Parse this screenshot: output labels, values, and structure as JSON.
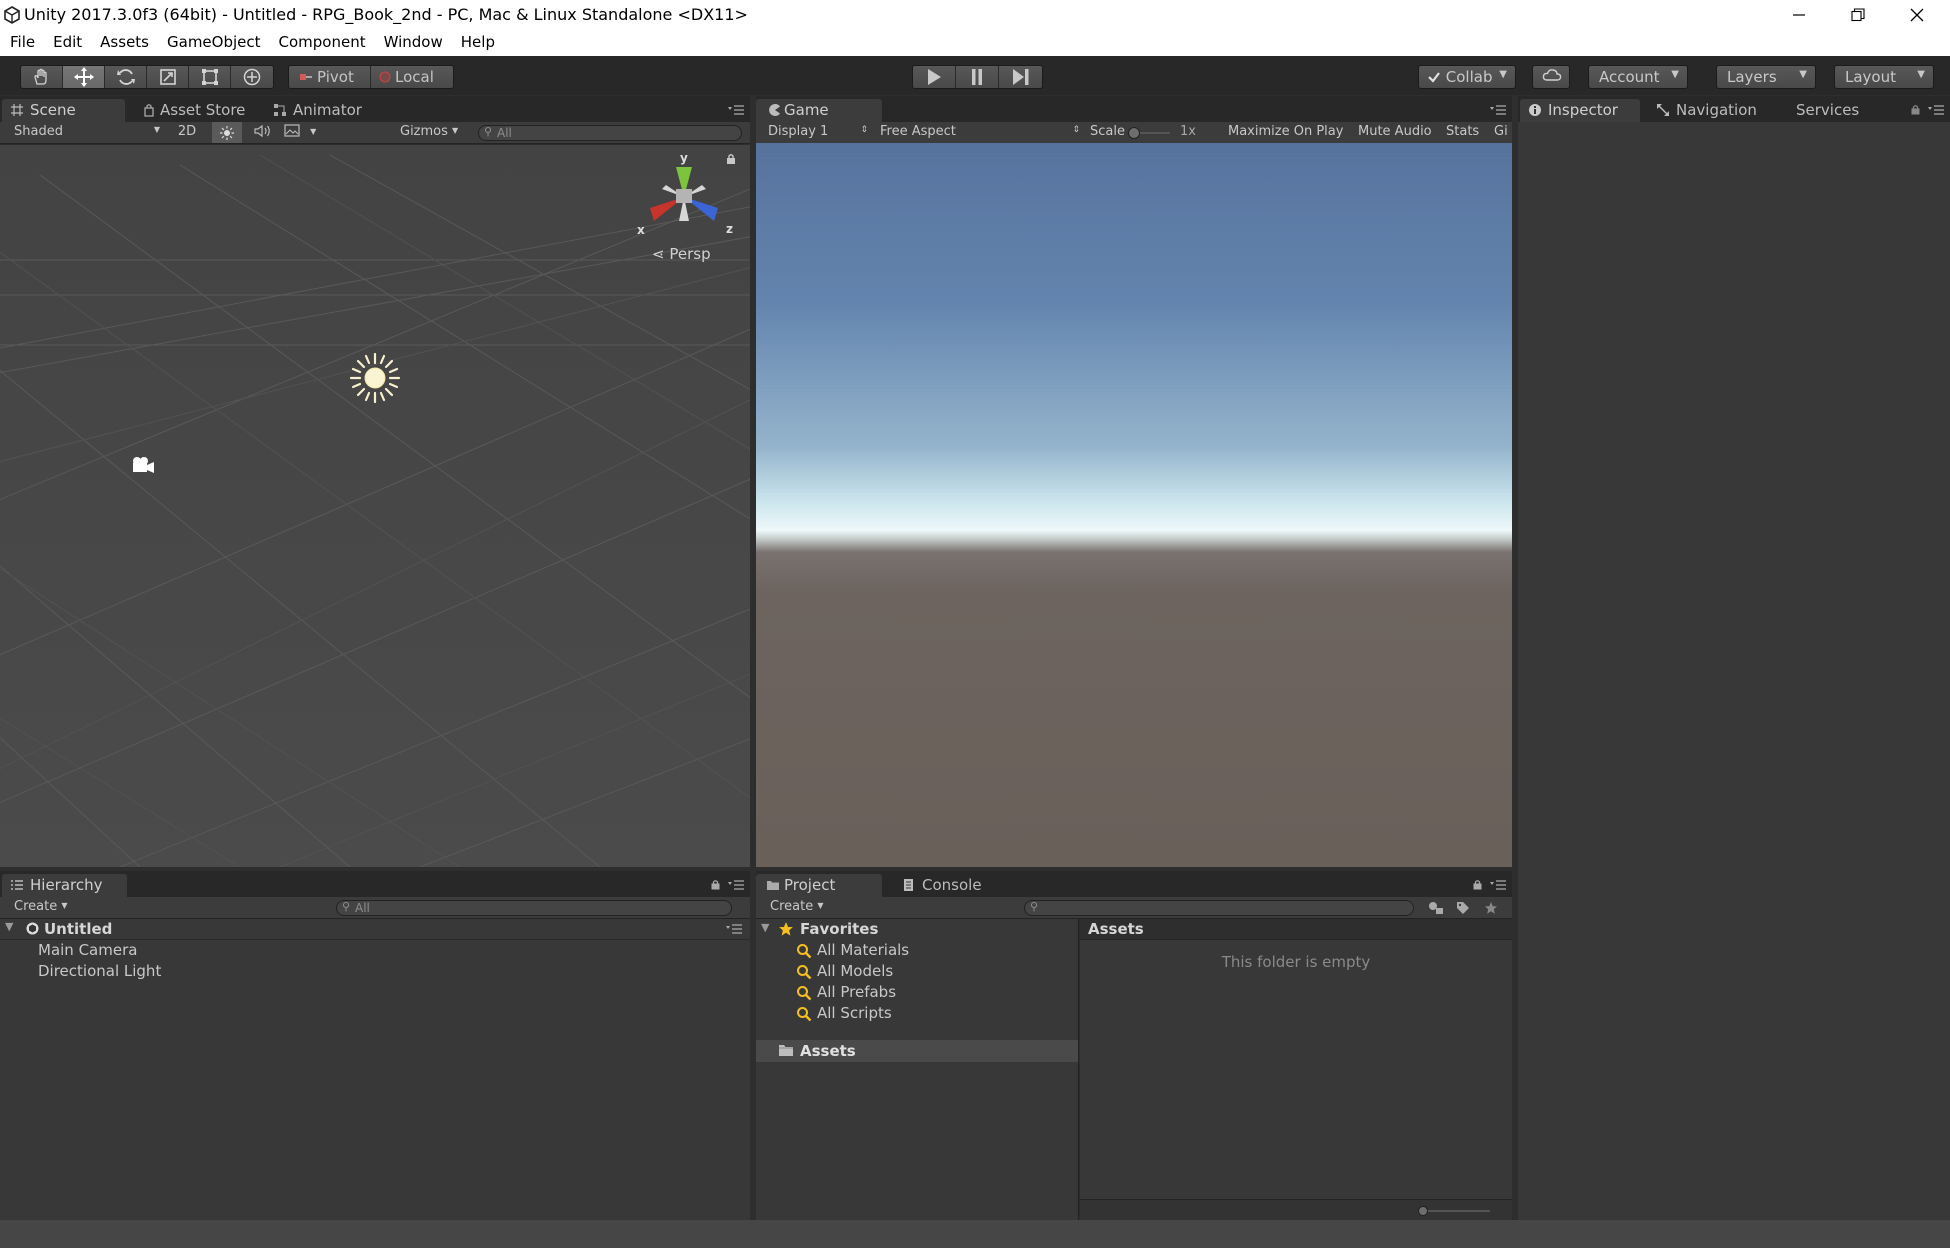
{
  "window": {
    "title": "Unity 2017.3.0f3 (64bit) - Untitled - RPG_Book_2nd - PC, Mac & Linux Standalone <DX11>"
  },
  "menu": [
    "File",
    "Edit",
    "Assets",
    "GameObject",
    "Component",
    "Window",
    "Help"
  ],
  "toolbar": {
    "pivot_label": "Pivot",
    "local_label": "Local",
    "collab_label": "Collab",
    "account_label": "Account",
    "layers_label": "Layers",
    "layout_label": "Layout"
  },
  "scene_panel": {
    "tabs": [
      "Scene",
      "Asset Store",
      "Animator"
    ],
    "shading_mode": "Shaded",
    "mode_2d": "2D",
    "gizmos_label": "Gizmos",
    "search_placeholder": "All",
    "projection_label": "Persp",
    "axis_labels": {
      "x": "x",
      "y": "y",
      "z": "z"
    }
  },
  "game_panel": {
    "tab": "Game",
    "display": "Display 1",
    "aspect": "Free Aspect",
    "scale_label": "Scale",
    "scale_value": "1x",
    "maximize_label": "Maximize On Play",
    "mute_label": "Mute Audio",
    "stats_label": "Stats",
    "gizmos_label": "Gi"
  },
  "inspector_panel": {
    "tabs": [
      "Inspector",
      "Navigation",
      "Services"
    ]
  },
  "hierarchy_panel": {
    "tab": "Hierarchy",
    "create_label": "Create",
    "search_placeholder": "All",
    "scene_name": "Untitled",
    "items": [
      "Main Camera",
      "Directional Light"
    ]
  },
  "project_panel": {
    "tabs": [
      "Project",
      "Console"
    ],
    "create_label": "Create",
    "favorites_label": "Favorites",
    "favorites": [
      "All Materials",
      "All Models",
      "All Prefabs",
      "All Scripts"
    ],
    "assets_folder": "Assets",
    "content_header": "Assets",
    "empty_message": "This folder is empty"
  },
  "colors": {
    "editor_bg": "#2e2e2e",
    "panel_header": "#3c3c3c",
    "sky_top": "#56739e",
    "horizon": "#eef8fa",
    "ground": "#6a605a",
    "scene_bg": "#464646",
    "favorite_star": "#f4c01f"
  }
}
